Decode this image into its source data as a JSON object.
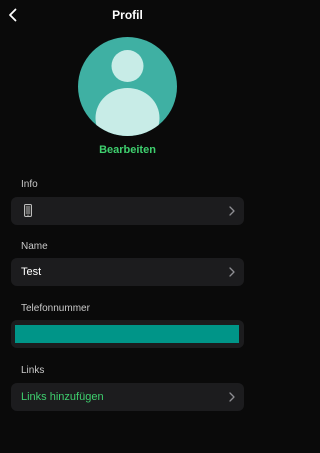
{
  "header": {
    "title": "Profil"
  },
  "profile": {
    "edit_label": "Bearbeiten"
  },
  "sections": {
    "info": {
      "label": "Info",
      "icon": "mobile-phone-icon"
    },
    "name": {
      "label": "Name",
      "value": "Test"
    },
    "phone": {
      "label": "Telefonnummer"
    },
    "links": {
      "label": "Links",
      "action": "Links hinzufügen"
    }
  },
  "colors": {
    "background": "#0a0a0a",
    "row_background": "#1c1c1e",
    "accent_green": "#3ecf6e",
    "avatar_teal": "#3fb0a3",
    "avatar_figure": "#c8ece7",
    "phone_bar": "#009588"
  }
}
